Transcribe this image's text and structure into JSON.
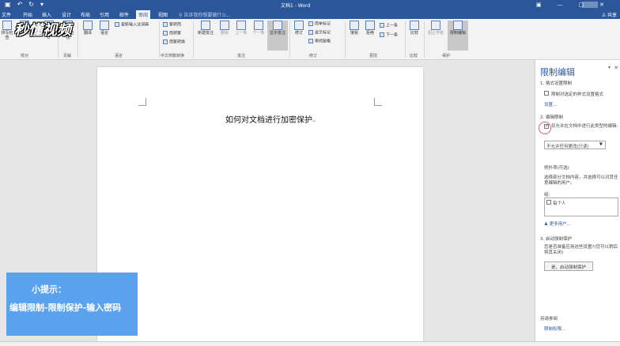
{
  "app": {
    "title": "文档1 - Word",
    "share": "共享",
    "window_controls": [
      "▣",
      "—",
      "▢",
      "✕"
    ]
  },
  "tabs": [
    "文件",
    "开始",
    "插入",
    "设计",
    "布局",
    "引用",
    "邮件",
    "审阅",
    "视图"
  ],
  "tell_me": "告诉我你想要做什么...",
  "ribbon": {
    "buttons": [
      "拼写检查",
      "同义词库",
      "字数统计",
      "智能查找",
      "翻译",
      "语言",
      "新建批注",
      "删除",
      "上一条",
      "下一条",
      "显示批注",
      "修订",
      "接受",
      "拒绝",
      "比较",
      "阻止作者",
      "限制编辑"
    ],
    "small": [
      "更新输入法词典",
      "繁转简",
      "简转繁",
      "简繁转换",
      "简单标记",
      "显示标记",
      "审阅窗格",
      "上一条",
      "下一条"
    ],
    "groups": [
      "校对",
      "见解",
      "语言",
      "中文简繁转换",
      "批注",
      "修订",
      "更改",
      "比较",
      "保护"
    ]
  },
  "watermark": "秒懂视频",
  "document": {
    "title": "如何对文档进行加密保护"
  },
  "tip": {
    "title": "小提示：",
    "text": "编辑限制-限制保护-输入密码"
  },
  "panel": {
    "title": "限制编辑",
    "s1": "1. 格式设置限制",
    "s1_check": "限制对选定的样式设置格式",
    "s1_link": "设置...",
    "s2": "2. 编辑限制",
    "s2_check": "仅允许在文档中进行此类型的编辑:",
    "s2_select": "不允许任何更改(只读)",
    "ex_title": "例外项(可选)",
    "ex_desc": "选择部分文档内容，并选择可以对其任意编辑的用户。",
    "group_label": "组:",
    "everyone": "每个人",
    "more_users": "更多用户...",
    "s3": "3. 启动强制保护",
    "s3_desc": "您是否准备应用这些设置?(您可以稍后将其关闭)",
    "s3_button": "是，启动强制保护",
    "see_also": "另请参阅",
    "perm_link": "限制权限..."
  }
}
